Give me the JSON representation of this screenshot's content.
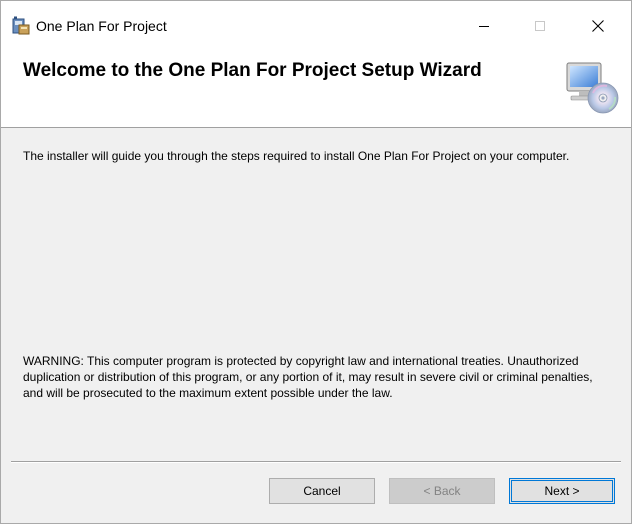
{
  "window": {
    "title": "One Plan For Project",
    "controls": {
      "minimize_icon": "minimize-icon",
      "maximize_icon": "maximize-icon",
      "close_icon": "close-icon"
    }
  },
  "header": {
    "title": "Welcome to the One Plan For Project Setup Wizard",
    "icon": "computer-disc-icon"
  },
  "body": {
    "intro": "The installer will guide you through the steps required to install One Plan For Project on your computer.",
    "warning": "WARNING: This computer program is protected by copyright law and international treaties. Unauthorized duplication or distribution of this program, or any portion of it, may result in severe civil or criminal penalties, and will be prosecuted to the maximum extent possible under the law."
  },
  "buttons": {
    "cancel": "Cancel",
    "back": "< Back",
    "next": "Next >"
  },
  "colors": {
    "accent": "#0078d7",
    "dialog_bg": "#f0f0f0",
    "header_bg": "#ffffff",
    "disabled_text": "#838383"
  }
}
